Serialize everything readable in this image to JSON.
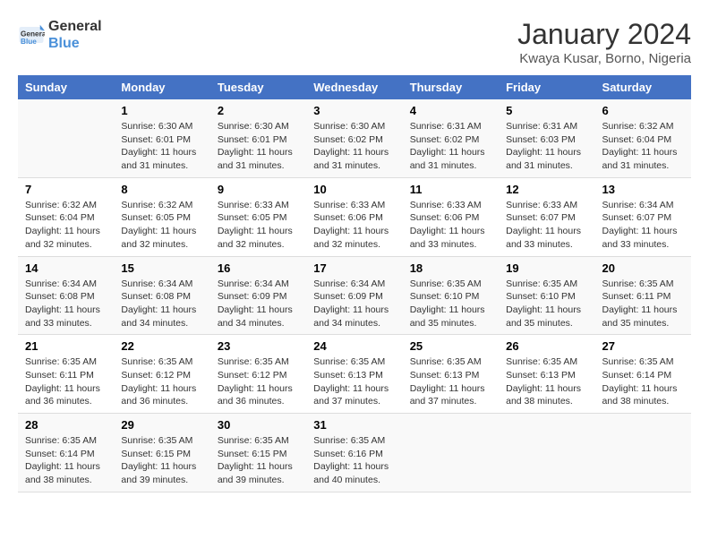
{
  "header": {
    "logo_line1": "General",
    "logo_line2": "Blue",
    "month_title": "January 2024",
    "location": "Kwaya Kusar, Borno, Nigeria"
  },
  "weekdays": [
    "Sunday",
    "Monday",
    "Tuesday",
    "Wednesday",
    "Thursday",
    "Friday",
    "Saturday"
  ],
  "weeks": [
    [
      {
        "day": "",
        "info": ""
      },
      {
        "day": "1",
        "info": "Sunrise: 6:30 AM\nSunset: 6:01 PM\nDaylight: 11 hours\nand 31 minutes."
      },
      {
        "day": "2",
        "info": "Sunrise: 6:30 AM\nSunset: 6:01 PM\nDaylight: 11 hours\nand 31 minutes."
      },
      {
        "day": "3",
        "info": "Sunrise: 6:30 AM\nSunset: 6:02 PM\nDaylight: 11 hours\nand 31 minutes."
      },
      {
        "day": "4",
        "info": "Sunrise: 6:31 AM\nSunset: 6:02 PM\nDaylight: 11 hours\nand 31 minutes."
      },
      {
        "day": "5",
        "info": "Sunrise: 6:31 AM\nSunset: 6:03 PM\nDaylight: 11 hours\nand 31 minutes."
      },
      {
        "day": "6",
        "info": "Sunrise: 6:32 AM\nSunset: 6:04 PM\nDaylight: 11 hours\nand 31 minutes."
      }
    ],
    [
      {
        "day": "7",
        "info": "Sunrise: 6:32 AM\nSunset: 6:04 PM\nDaylight: 11 hours\nand 32 minutes."
      },
      {
        "day": "8",
        "info": "Sunrise: 6:32 AM\nSunset: 6:05 PM\nDaylight: 11 hours\nand 32 minutes."
      },
      {
        "day": "9",
        "info": "Sunrise: 6:33 AM\nSunset: 6:05 PM\nDaylight: 11 hours\nand 32 minutes."
      },
      {
        "day": "10",
        "info": "Sunrise: 6:33 AM\nSunset: 6:06 PM\nDaylight: 11 hours\nand 32 minutes."
      },
      {
        "day": "11",
        "info": "Sunrise: 6:33 AM\nSunset: 6:06 PM\nDaylight: 11 hours\nand 33 minutes."
      },
      {
        "day": "12",
        "info": "Sunrise: 6:33 AM\nSunset: 6:07 PM\nDaylight: 11 hours\nand 33 minutes."
      },
      {
        "day": "13",
        "info": "Sunrise: 6:34 AM\nSunset: 6:07 PM\nDaylight: 11 hours\nand 33 minutes."
      }
    ],
    [
      {
        "day": "14",
        "info": "Sunrise: 6:34 AM\nSunset: 6:08 PM\nDaylight: 11 hours\nand 33 minutes."
      },
      {
        "day": "15",
        "info": "Sunrise: 6:34 AM\nSunset: 6:08 PM\nDaylight: 11 hours\nand 34 minutes."
      },
      {
        "day": "16",
        "info": "Sunrise: 6:34 AM\nSunset: 6:09 PM\nDaylight: 11 hours\nand 34 minutes."
      },
      {
        "day": "17",
        "info": "Sunrise: 6:34 AM\nSunset: 6:09 PM\nDaylight: 11 hours\nand 34 minutes."
      },
      {
        "day": "18",
        "info": "Sunrise: 6:35 AM\nSunset: 6:10 PM\nDaylight: 11 hours\nand 35 minutes."
      },
      {
        "day": "19",
        "info": "Sunrise: 6:35 AM\nSunset: 6:10 PM\nDaylight: 11 hours\nand 35 minutes."
      },
      {
        "day": "20",
        "info": "Sunrise: 6:35 AM\nSunset: 6:11 PM\nDaylight: 11 hours\nand 35 minutes."
      }
    ],
    [
      {
        "day": "21",
        "info": "Sunrise: 6:35 AM\nSunset: 6:11 PM\nDaylight: 11 hours\nand 36 minutes."
      },
      {
        "day": "22",
        "info": "Sunrise: 6:35 AM\nSunset: 6:12 PM\nDaylight: 11 hours\nand 36 minutes."
      },
      {
        "day": "23",
        "info": "Sunrise: 6:35 AM\nSunset: 6:12 PM\nDaylight: 11 hours\nand 36 minutes."
      },
      {
        "day": "24",
        "info": "Sunrise: 6:35 AM\nSunset: 6:13 PM\nDaylight: 11 hours\nand 37 minutes."
      },
      {
        "day": "25",
        "info": "Sunrise: 6:35 AM\nSunset: 6:13 PM\nDaylight: 11 hours\nand 37 minutes."
      },
      {
        "day": "26",
        "info": "Sunrise: 6:35 AM\nSunset: 6:13 PM\nDaylight: 11 hours\nand 38 minutes."
      },
      {
        "day": "27",
        "info": "Sunrise: 6:35 AM\nSunset: 6:14 PM\nDaylight: 11 hours\nand 38 minutes."
      }
    ],
    [
      {
        "day": "28",
        "info": "Sunrise: 6:35 AM\nSunset: 6:14 PM\nDaylight: 11 hours\nand 38 minutes."
      },
      {
        "day": "29",
        "info": "Sunrise: 6:35 AM\nSunset: 6:15 PM\nDaylight: 11 hours\nand 39 minutes."
      },
      {
        "day": "30",
        "info": "Sunrise: 6:35 AM\nSunset: 6:15 PM\nDaylight: 11 hours\nand 39 minutes."
      },
      {
        "day": "31",
        "info": "Sunrise: 6:35 AM\nSunset: 6:16 PM\nDaylight: 11 hours\nand 40 minutes."
      },
      {
        "day": "",
        "info": ""
      },
      {
        "day": "",
        "info": ""
      },
      {
        "day": "",
        "info": ""
      }
    ]
  ]
}
